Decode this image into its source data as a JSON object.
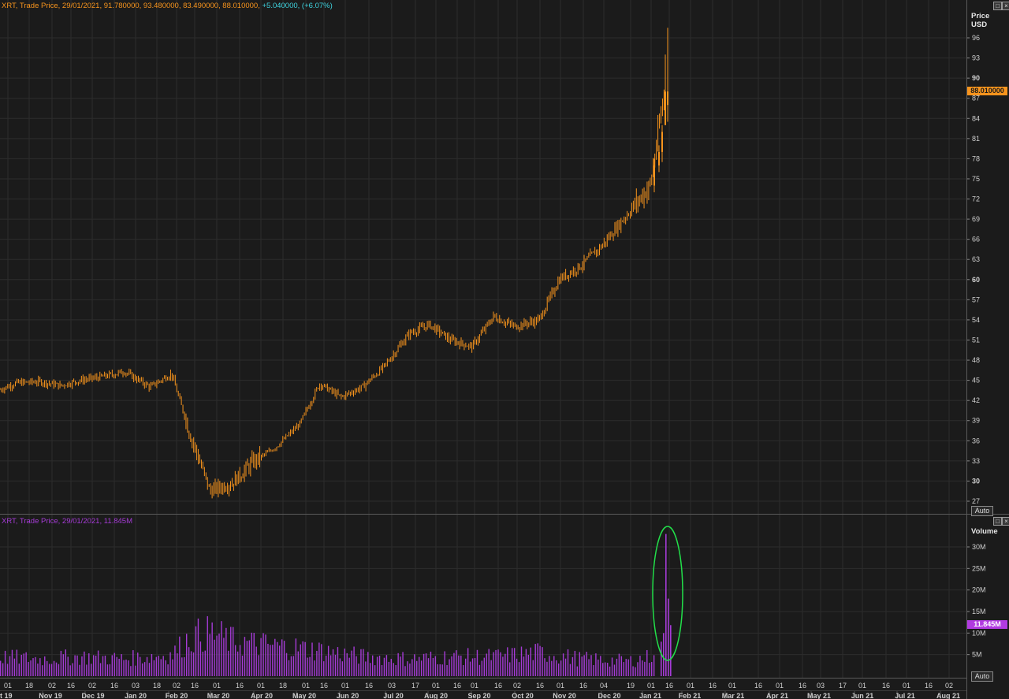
{
  "price_panel": {
    "header": {
      "ticker": "XRT, Trade Price, 29/01/2021, 91.780000, 93.480000, 83.490000, 88.010000,",
      "change": "+5.040000, (+6.07%)"
    },
    "axis_title_line1": "Price",
    "axis_title_line2": "USD",
    "last_value_tag": "88.010000",
    "auto_label": "Auto"
  },
  "volume_panel": {
    "header": "XRT, Trade Price, 29/01/2021, 11.845M",
    "axis_title": "Volume",
    "last_value_tag": "11.845M",
    "auto_label": "Auto"
  },
  "colors": {
    "background": "#1b1b1b",
    "candle": "#f7941d",
    "volume": "#a53bd6",
    "change_text": "#3fd4e0",
    "highlight_ellipse": "#22e04a",
    "grid": "#2c2c2c"
  },
  "chart_data": [
    {
      "type": "line",
      "series_style": "candlestick",
      "ylabel": "Price USD",
      "ylim": [
        26,
        98
      ],
      "y_ticks": [
        27,
        30,
        33,
        36,
        39,
        42,
        45,
        48,
        51,
        54,
        57,
        60,
        63,
        66,
        69,
        72,
        75,
        78,
        81,
        84,
        87,
        90,
        93,
        96
      ],
      "x_ticks": [
        "01",
        "18",
        "02",
        "16",
        "02",
        "16",
        "03",
        "18",
        "02",
        "16",
        "01",
        "16",
        "01",
        "18",
        "01",
        "16",
        "01",
        "16",
        "03",
        "17",
        "01",
        "16",
        "01",
        "16",
        "02",
        "16",
        "01",
        "16",
        "04",
        "19",
        "01",
        "16",
        "01",
        "16",
        "01",
        "16",
        "01",
        "16",
        "03",
        "17",
        "01",
        "16",
        "01",
        "16",
        "02",
        "16"
      ],
      "x_month_labels": [
        "t 19",
        "Nov 19",
        "Dec 19",
        "Jan 20",
        "Feb 20",
        "Mar 20",
        "Apr 20",
        "May 20",
        "Jun 20",
        "Jul 20",
        "Aug 20",
        "Sep 20",
        "Oct 20",
        "Nov 20",
        "Dec 20",
        "Jan 21",
        "Feb 21",
        "Mar 21",
        "Apr 21",
        "May 21",
        "Jun 21",
        "Jul 21",
        "Aug 21"
      ],
      "x_dates": [
        "2019-10-16",
        "2019-11-01",
        "2019-11-18",
        "2019-12-02",
        "2019-12-16",
        "2020-01-02",
        "2020-01-16",
        "2020-02-03",
        "2020-02-18",
        "2020-03-02",
        "2020-03-16",
        "2020-04-01",
        "2020-04-16",
        "2020-05-01",
        "2020-05-18",
        "2020-06-01",
        "2020-06-16",
        "2020-07-01",
        "2020-07-16",
        "2020-08-03",
        "2020-08-17",
        "2020-09-01",
        "2020-09-16",
        "2020-10-01",
        "2020-10-16",
        "2020-11-02",
        "2020-11-16",
        "2020-12-01",
        "2020-12-16",
        "2021-01-04",
        "2021-01-19",
        "2021-01-29"
      ],
      "y_close": [
        43.2,
        44.6,
        44.8,
        44.2,
        45.0,
        45.6,
        46.3,
        44.0,
        46.0,
        37.0,
        28.5,
        29.8,
        33.0,
        35.0,
        38.5,
        44.5,
        42.5,
        44.0,
        47.0,
        52.0,
        53.3,
        51.0,
        50.0,
        54.5,
        53.0,
        54.0,
        60.0,
        62.0,
        65.0,
        70.0,
        74.0,
        88.01
      ]
    },
    {
      "type": "bar",
      "ylabel": "Volume",
      "y_ticks": [
        "5M",
        "10M",
        "15M",
        "20M",
        "25M",
        "30M"
      ],
      "ylim": [
        0,
        34
      ],
      "x_dates": [
        "2019-10-16",
        "2019-11-18",
        "2019-12-16",
        "2020-01-16",
        "2020-02-18",
        "2020-03-02",
        "2020-03-16",
        "2020-04-01",
        "2020-05-01",
        "2020-06-01",
        "2020-07-01",
        "2020-08-03",
        "2020-09-01",
        "2020-10-01",
        "2020-11-02",
        "2020-12-01",
        "2021-01-04",
        "2021-01-19",
        "2021-01-25",
        "2021-01-27",
        "2021-01-28",
        "2021-01-29"
      ],
      "values": [
        4.5,
        4.0,
        4.5,
        4.0,
        5.0,
        9.0,
        10.0,
        8.0,
        7.0,
        6.0,
        4.5,
        4.0,
        4.5,
        4.5,
        5.5,
        4.0,
        3.5,
        4.5,
        10.0,
        33.0,
        18.0,
        11.845
      ]
    }
  ]
}
